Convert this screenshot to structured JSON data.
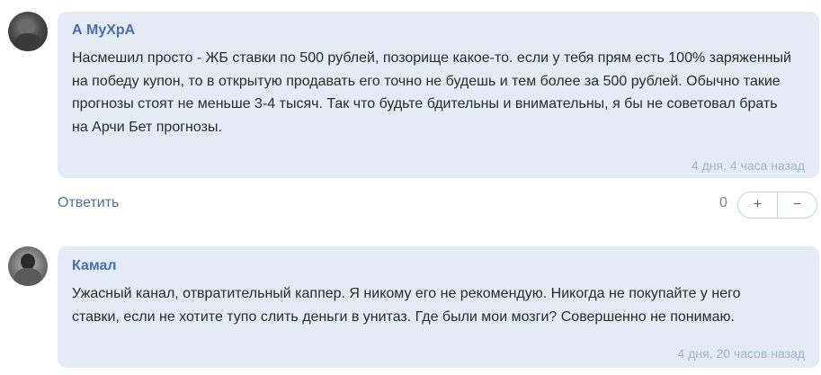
{
  "comments": [
    {
      "author": "А МуХрА",
      "text": "Насмешил просто - ЖБ ставки по 500 рублей, позорище какое-то. если у тебя прям есть 100% заряженный на победу купон, то в открытую продавать его точно не будешь и тем более за 500 рублей. Обычно такие прогнозы стоят не меньше 3-4 тысяч. Так что будьте бдительны и внимательны, я бы не советовал брать на Арчи Бет прогнозы.",
      "time": "4 дня, 4 часа назад"
    },
    {
      "author": "Камал",
      "text": "Ужасный канал, отвратительный каппер. Я никому его не рекомендую. Никогда не покупайте у него ставки, если не хотите тупо слить деньги в унитаз. Где были мои мозги? Совершенно не понимаю.",
      "time": "4 дня, 20 часов назад"
    }
  ],
  "actions": {
    "reply_label": "Ответить",
    "vote_count": "0",
    "plus": "+",
    "minus": "−"
  },
  "colors": {
    "bubble_bg": "#e4ebf5",
    "author": "#4a6fa5",
    "time": "#9fb3cf"
  }
}
